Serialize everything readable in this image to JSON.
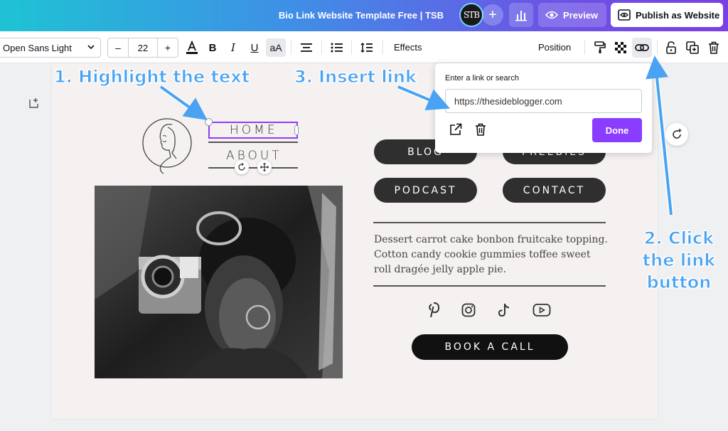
{
  "topbar": {
    "doc_title": "Bio Link Website Template Free | TSB",
    "avatar_initials": "STB",
    "plus_label": "+",
    "preview_label": "Preview",
    "publish_label": "Publish as Website",
    "accent": "#8b3dff"
  },
  "toolbar": {
    "font_family_value": "Open Sans Light",
    "font_size_minus": "–",
    "font_size_value": "22",
    "font_size_plus": "+",
    "bold_label": "B",
    "italic_label": "I",
    "underline_label": "U",
    "case_label": "aA",
    "effects_label": "Effects",
    "position_label": "Position"
  },
  "link_popup": {
    "label": "Enter a link or search",
    "input_value": "https://thesideblogger.com",
    "done_label": "Done"
  },
  "page": {
    "nav_home": "HOME",
    "nav_about": "ABOUT",
    "buttons": {
      "blog": "BLOG",
      "freebies": "FREEBIES",
      "podcast": "PODCAST",
      "contact": "CONTACT"
    },
    "bio_text": "Dessert carrot cake bonbon fruitcake topping. Cotton candy cookie gummies toffee sweet roll dragée jelly apple pie.",
    "book_label": "BOOK A CALL",
    "social_icons": [
      "pinterest-icon",
      "instagram-icon",
      "tiktok-icon",
      "youtube-icon"
    ]
  },
  "annotations": {
    "step1": "1. Highlight the text",
    "step2_line1": "2. Click",
    "step2_line2": "the link",
    "step2_line3": "button",
    "step3": "3. Insert link",
    "color": "#4aa3f2"
  }
}
